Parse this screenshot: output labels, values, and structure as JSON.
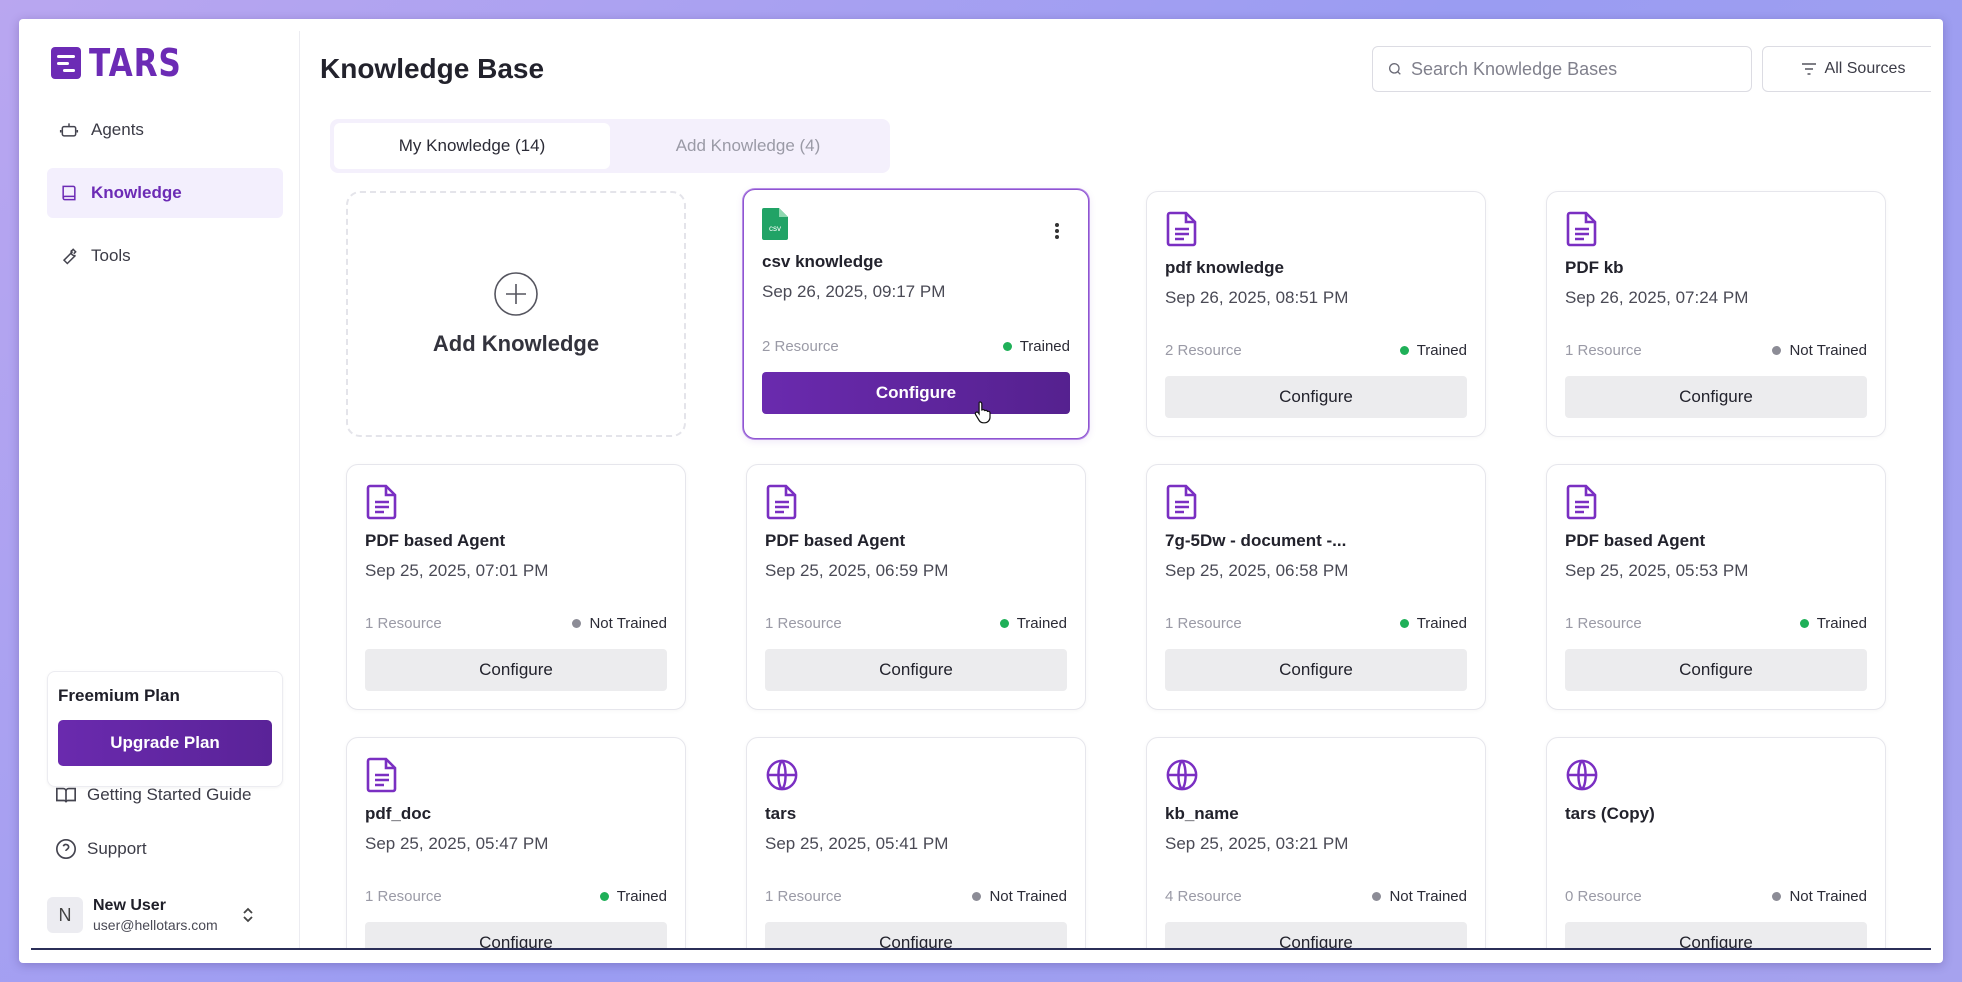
{
  "brand": {
    "name": "TARS",
    "color": "#6c2bb5"
  },
  "sidebar": {
    "nav": [
      {
        "label": "Agents",
        "icon": "robot-icon",
        "active": false
      },
      {
        "label": "Knowledge",
        "icon": "book-icon",
        "active": true
      },
      {
        "label": "Tools",
        "icon": "wrench-icon",
        "active": false
      }
    ],
    "plan": {
      "title": "Freemium Plan",
      "upgrade_label": "Upgrade Plan"
    },
    "links": [
      {
        "label": "Getting Started Guide",
        "icon": "open-book-icon"
      },
      {
        "label": "Support",
        "icon": "help-circle-icon"
      }
    ],
    "user": {
      "initial": "N",
      "name": "New User",
      "email": "user@hellotars.com"
    }
  },
  "header": {
    "title": "Knowledge Base",
    "search_placeholder": "Search Knowledge Bases",
    "filter_label": "All Sources"
  },
  "tabs": [
    {
      "label": "My Knowledge (14)",
      "active": true
    },
    {
      "label": "Add Knowledge (4)",
      "active": false
    }
  ],
  "add_card": {
    "label": "Add Knowledge"
  },
  "configure_label": "Configure",
  "knowledge_bases": [
    {
      "name": "csv knowledge",
      "date": "Sep 26, 2025, 09:17 PM",
      "resources": "2 Resource",
      "status": "Trained",
      "type": "csv",
      "selected": true
    },
    {
      "name": "pdf knowledge",
      "date": "Sep 26, 2025, 08:51 PM",
      "resources": "2 Resource",
      "status": "Trained",
      "type": "doc"
    },
    {
      "name": "PDF kb",
      "date": "Sep 26, 2025, 07:24 PM",
      "resources": "1 Resource",
      "status": "Not Trained",
      "type": "doc"
    },
    {
      "name": "PDF based Agent",
      "date": "Sep 25, 2025, 07:01 PM",
      "resources": "1 Resource",
      "status": "Not Trained",
      "type": "doc"
    },
    {
      "name": "PDF based Agent",
      "date": "Sep 25, 2025, 06:59 PM",
      "resources": "1 Resource",
      "status": "Trained",
      "type": "doc"
    },
    {
      "name": "7g-5Dw - document -...",
      "date": "Sep 25, 2025, 06:58 PM",
      "resources": "1 Resource",
      "status": "Trained",
      "type": "doc"
    },
    {
      "name": "PDF based Agent",
      "date": "Sep 25, 2025, 05:53 PM",
      "resources": "1 Resource",
      "status": "Trained",
      "type": "doc"
    },
    {
      "name": "pdf_doc",
      "date": "Sep 25, 2025, 05:47 PM",
      "resources": "1 Resource",
      "status": "Trained",
      "type": "doc"
    },
    {
      "name": "tars",
      "date": "Sep 25, 2025, 05:41 PM",
      "resources": "1 Resource",
      "status": "Not Trained",
      "type": "web"
    },
    {
      "name": "kb_name",
      "date": "Sep 25, 2025, 03:21 PM",
      "resources": "4 Resource",
      "status": "Not Trained",
      "type": "web"
    },
    {
      "name": "tars (Copy)",
      "date": "",
      "resources": "0 Resource",
      "status": "Not Trained",
      "type": "web"
    }
  ],
  "csv_badge": "csv"
}
